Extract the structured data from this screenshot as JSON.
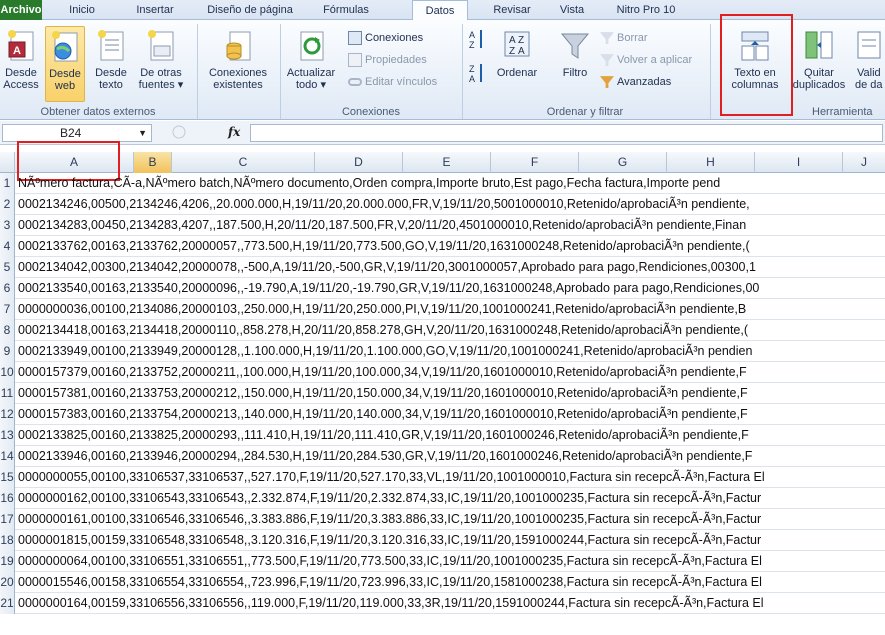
{
  "ribbon_tabs": [
    "Archivo",
    "Inicio",
    "Insertar",
    "Diseño de página",
    "Fórmulas",
    "Datos",
    "Revisar",
    "Vista",
    "Nitro Pro 10"
  ],
  "ext_data": {
    "btn_access": [
      "Desde",
      "Access"
    ],
    "btn_web": [
      "Desde",
      "web"
    ],
    "btn_text": [
      "Desde",
      "texto"
    ],
    "btn_other": [
      "De otras",
      "fuentes ▾"
    ],
    "group_label": "Obtener datos externos"
  },
  "existing": {
    "label": [
      "Conexiones",
      "existentes"
    ]
  },
  "connections": {
    "btn_refresh": [
      "Actualizar",
      "todo ▾"
    ],
    "conexiones": "Conexiones",
    "propiedades": "Propiedades",
    "editar": "Editar vínculos",
    "group_label": "Conexiones"
  },
  "sort_filter": {
    "ordenar": "Ordenar",
    "filtro": "Filtro",
    "borrar": "Borrar",
    "volver": "Volver a aplicar",
    "avanzadas": "Avanzadas",
    "group_label": "Ordenar y filtrar"
  },
  "data_tools": {
    "texto_columnas": [
      "Texto en",
      "columnas"
    ],
    "quitar": [
      "Quitar",
      "duplicados"
    ],
    "validar": [
      "Valid",
      "de da"
    ],
    "group_label": "Herramienta"
  },
  "formula_bar": {
    "cell_ref": "B24",
    "fx": "fx"
  },
  "columns": [
    "A",
    "B",
    "C",
    "D",
    "E",
    "F",
    "G",
    "H",
    "I",
    "J"
  ],
  "rows": [
    {
      "n": "1",
      "text": "NÃºmero factura,CÃ-a,NÃºmero batch,NÃºmero documento,Orden compra,Importe bruto,Est pago,Fecha factura,Importe pend"
    },
    {
      "n": "2",
      "text": "0002134246,00500,2134246,4206,,20.000.000,H,19/11/20,20.000.000,FR,V,19/11/20,5001000010,Retenido/aprobaciÃ³n pendiente,"
    },
    {
      "n": "3",
      "text": "0002134283,00450,2134283,4207,,187.500,H,20/11/20,187.500,FR,V,20/11/20,4501000010,Retenido/aprobaciÃ³n pendiente,Finan"
    },
    {
      "n": "4",
      "text": "0002133762,00163,2133762,20000057,,773.500,H,19/11/20,773.500,GO,V,19/11/20,1631000248,Retenido/aprobaciÃ³n pendiente,("
    },
    {
      "n": "5",
      "text": "0002134042,00300,2134042,20000078,,-500,A,19/11/20,-500,GR,V,19/11/20,3001000057,Aprobado para pago,Rendiciones,00300,1"
    },
    {
      "n": "6",
      "text": "0002133540,00163,2133540,20000096,,-19.790,A,19/11/20,-19.790,GR,V,19/11/20,1631000248,Aprobado para pago,Rendiciones,00"
    },
    {
      "n": "7",
      "text": "0000000036,00100,2134086,20000103,,250.000,H,19/11/20,250.000,PI,V,19/11/20,1001000241,Retenido/aprobaciÃ³n pendiente,B"
    },
    {
      "n": "8",
      "text": "0002134418,00163,2134418,20000110,,858.278,H,20/11/20,858.278,GH,V,20/11/20,1631000248,Retenido/aprobaciÃ³n pendiente,("
    },
    {
      "n": "9",
      "text": "0002133949,00100,2133949,20000128,,1.100.000,H,19/11/20,1.100.000,GO,V,19/11/20,1001000241,Retenido/aprobaciÃ³n pendien"
    },
    {
      "n": "10",
      "text": "0000157379,00160,2133752,20000211,,100.000,H,19/11/20,100.000,34,V,19/11/20,1601000010,Retenido/aprobaciÃ³n pendiente,F"
    },
    {
      "n": "11",
      "text": "0000157381,00160,2133753,20000212,,150.000,H,19/11/20,150.000,34,V,19/11/20,1601000010,Retenido/aprobaciÃ³n pendiente,F"
    },
    {
      "n": "12",
      "text": "0000157383,00160,2133754,20000213,,140.000,H,19/11/20,140.000,34,V,19/11/20,1601000010,Retenido/aprobaciÃ³n pendiente,F"
    },
    {
      "n": "13",
      "text": "0002133825,00160,2133825,20000293,,111.410,H,19/11/20,111.410,GR,V,19/11/20,1601000246,Retenido/aprobaciÃ³n pendiente,F"
    },
    {
      "n": "14",
      "text": "0002133946,00160,2133946,20000294,,284.530,H,19/11/20,284.530,GR,V,19/11/20,1601000246,Retenido/aprobaciÃ³n pendiente,F"
    },
    {
      "n": "15",
      "text": "0000000055,00100,33106537,33106537,,527.170,F,19/11/20,527.170,33,VL,19/11/20,1001000010,Factura sin recepcÃ-Ã³n,Factura El"
    },
    {
      "n": "16",
      "text": "0000000162,00100,33106543,33106543,,2.332.874,F,19/11/20,2.332.874,33,IC,19/11/20,1001000235,Factura sin recepcÃ-Ã³n,Factur"
    },
    {
      "n": "17",
      "text": "0000000161,00100,33106546,33106546,,3.383.886,F,19/11/20,3.383.886,33,IC,19/11/20,1001000235,Factura sin recepcÃ-Ã³n,Factur"
    },
    {
      "n": "18",
      "text": "0000001815,00159,33106548,33106548,,3.120.316,F,19/11/20,3.120.316,33,IC,19/11/20,1591000244,Factura sin recepcÃ-Ã³n,Factur"
    },
    {
      "n": "19",
      "text": "0000000064,00100,33106551,33106551,,773.500,F,19/11/20,773.500,33,IC,19/11/20,1001000235,Factura sin recepcÃ-Ã³n,Factura El"
    },
    {
      "n": "20",
      "text": "0000015546,00158,33106554,33106554,,723.996,F,19/11/20,723.996,33,IC,19/11/20,1581000238,Factura sin recepcÃ-Ã³n,Factura El"
    },
    {
      "n": "21",
      "text": "0000000164,00159,33106556,33106556,,119.000,F,19/11/20,119.000,33,3R,19/11/20,1591000244,Factura sin recepcÃ-Ã³n,Factura El"
    }
  ]
}
